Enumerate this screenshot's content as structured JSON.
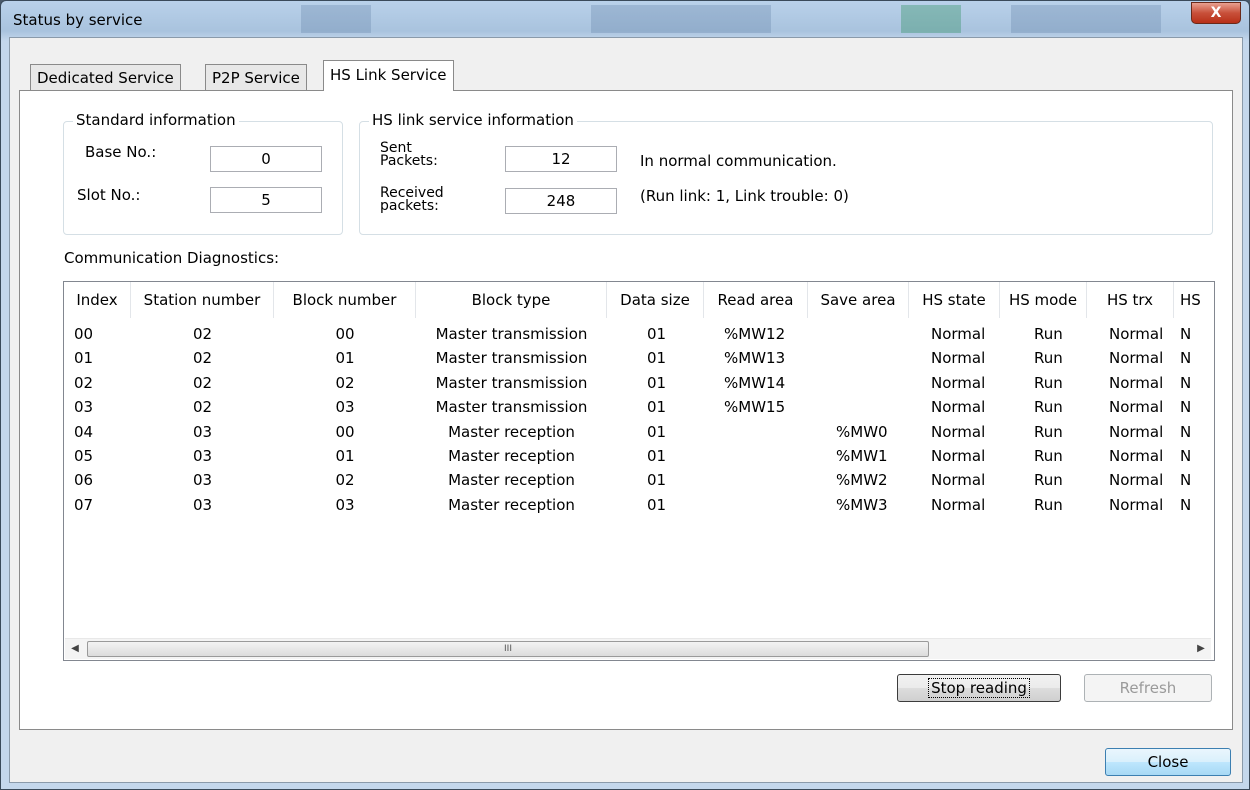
{
  "window": {
    "title": "Status by service",
    "close_glyph": "X"
  },
  "tabs": [
    {
      "label": "Dedicated Service"
    },
    {
      "label": "P2P Service"
    },
    {
      "label": "HS Link Service"
    }
  ],
  "standard": {
    "title": "Standard information",
    "base_label": "Base No.:",
    "base_value": "0",
    "slot_label": "Slot No.:",
    "slot_value": "5"
  },
  "hslink": {
    "title": "HS link service information",
    "sent_label_1": "Sent",
    "sent_label_2": "Packets:",
    "sent_value": "12",
    "recv_label_1": "Received",
    "recv_label_2": "packets:",
    "recv_value": "248",
    "status_line": "In normal communication.",
    "detail_line": "(Run link: 1, Link trouble: 0)"
  },
  "diagnostics": {
    "label": "Communication Diagnostics:",
    "columns": [
      "Index",
      "Station number",
      "Block number",
      "Block type",
      "Data size",
      "Read area",
      "Save area",
      "HS state",
      "HS mode",
      "HS trx",
      "HS"
    ],
    "rows": [
      [
        "00",
        "02",
        "00",
        "Master transmission",
        "01",
        "%MW12",
        "",
        "Normal",
        "Run",
        "Normal",
        "N"
      ],
      [
        "01",
        "02",
        "01",
        "Master transmission",
        "01",
        "%MW13",
        "",
        "Normal",
        "Run",
        "Normal",
        "N"
      ],
      [
        "02",
        "02",
        "02",
        "Master transmission",
        "01",
        "%MW14",
        "",
        "Normal",
        "Run",
        "Normal",
        "N"
      ],
      [
        "03",
        "02",
        "03",
        "Master transmission",
        "01",
        "%MW15",
        "",
        "Normal",
        "Run",
        "Normal",
        "N"
      ],
      [
        "04",
        "03",
        "00",
        "Master reception",
        "01",
        "",
        "%MW0",
        "Normal",
        "Run",
        "Normal",
        "N"
      ],
      [
        "05",
        "03",
        "01",
        "Master reception",
        "01",
        "",
        "%MW1",
        "Normal",
        "Run",
        "Normal",
        "N"
      ],
      [
        "06",
        "03",
        "02",
        "Master reception",
        "01",
        "",
        "%MW2",
        "Normal",
        "Run",
        "Normal",
        "N"
      ],
      [
        "07",
        "03",
        "03",
        "Master reception",
        "01",
        "",
        "%MW3",
        "Normal",
        "Run",
        "Normal",
        "N"
      ]
    ],
    "scroll_left": "◀",
    "scroll_right": "▶",
    "scroll_grip": "III"
  },
  "buttons": {
    "stop_reading": "Stop reading",
    "refresh": "Refresh",
    "close": "Close"
  }
}
